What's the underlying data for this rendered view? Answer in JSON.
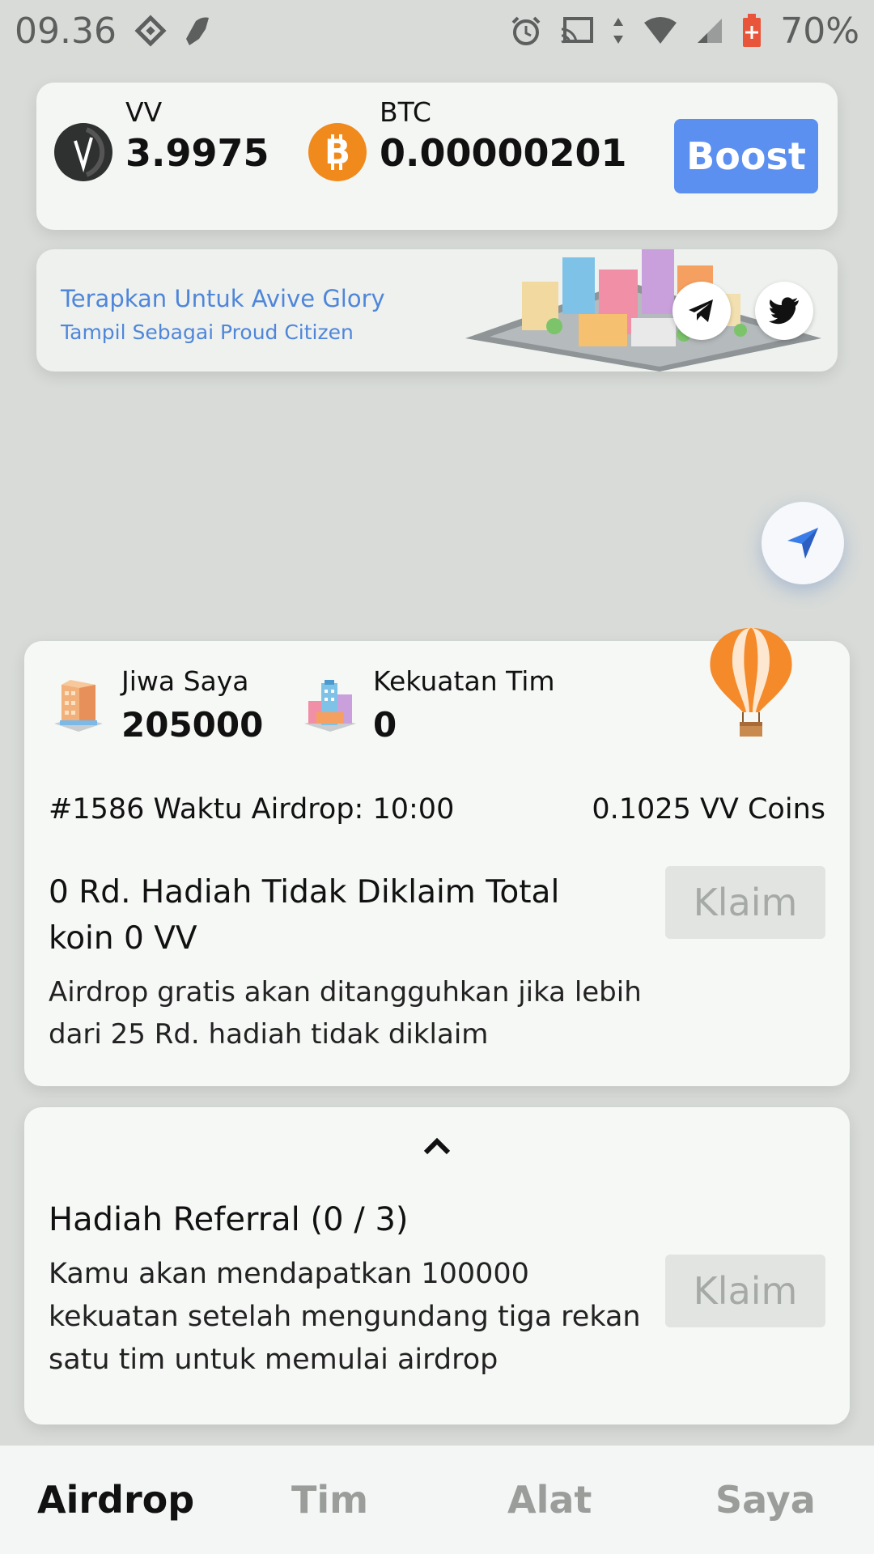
{
  "status_bar": {
    "time": "09.36",
    "battery": "70%",
    "icons": [
      "binance-icon",
      "shoe-icon",
      "alarm-icon",
      "cast-icon",
      "data-arrows-icon",
      "wifi-icon",
      "signal-icon",
      "battery-icon"
    ]
  },
  "balance": {
    "vv": {
      "name": "VV",
      "value": "3.9975"
    },
    "btc": {
      "name": "BTC",
      "value": "0.00000201"
    },
    "boost_label": "Boost",
    "accent": "#5b90f0"
  },
  "banner": {
    "title": "Terapkan Untuk Avive Glory",
    "subtitle": "Tampil Sebagai Proud Citizen"
  },
  "airdrop": {
    "jiwa_label": "Jiwa Saya",
    "jiwa_value": "205000",
    "kekuatan_label": "Kekuatan Tim",
    "kekuatan_value": "0",
    "round_line": "#1586 Waktu Airdrop: 10:00",
    "coins_line": "0.1025 VV Coins",
    "unclaimed": "0 Rd. Hadiah Tidak Diklaim Total koin 0 VV",
    "note": "Airdrop gratis akan ditangguhkan jika lebih dari 25 Rd. hadiah tidak diklaim",
    "claim_label": "Klaim"
  },
  "referral": {
    "title": "Hadiah Referral (0 / 3)",
    "desc": "Kamu akan mendapatkan 100000 kekuatan setelah mengundang tiga rekan satu tim untuk memulai airdrop",
    "claim_label": "Klaim"
  },
  "bottom_nav": {
    "items": [
      "Airdrop",
      "Tim",
      "Alat",
      "Saya"
    ],
    "active": "Airdrop"
  }
}
